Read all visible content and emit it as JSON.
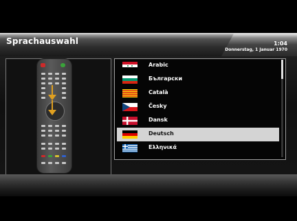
{
  "header": {
    "title": "Sprachauswahl",
    "time": "1:04",
    "date": "Donnerstag, 1 Januar 1970"
  },
  "languages": [
    {
      "label": "Arabic",
      "flag": "flag-syria"
    },
    {
      "label": "Български",
      "flag": "flag-bulgaria"
    },
    {
      "label": "Català",
      "flag": "flag-catalonia"
    },
    {
      "label": "Česky",
      "flag": "flag-czech"
    },
    {
      "label": "Dansk",
      "flag": "flag-denmark"
    },
    {
      "label": "Deutsch",
      "flag": "flag-germany",
      "selected": true
    },
    {
      "label": "Ελληνικά",
      "flag": "flag-greece"
    }
  ],
  "colors": {
    "selected_row": "#d4d4d4",
    "arrow": "#e0a020"
  }
}
